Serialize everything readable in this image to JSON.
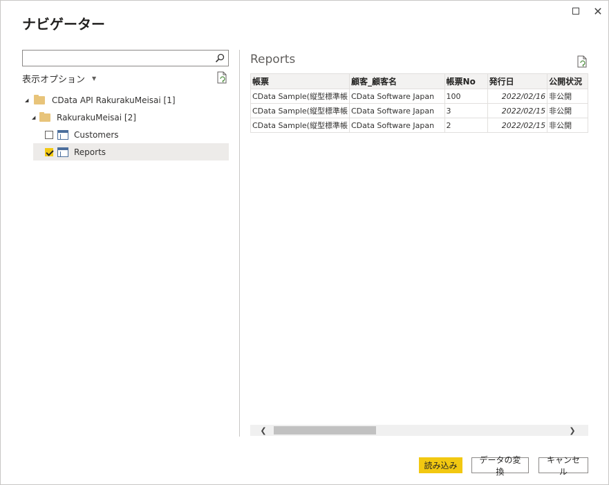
{
  "dialog": {
    "title": "ナビゲーター"
  },
  "left": {
    "search_value": "",
    "display_options_label": "表示オプション",
    "tree": [
      {
        "label": "CData API RakurakuMeisai [1]",
        "kind": "folder",
        "expanded": true
      },
      {
        "label": "RakurakuMeisai [2]",
        "kind": "folder",
        "expanded": true
      },
      {
        "label": "Customers",
        "kind": "table",
        "checked": false
      },
      {
        "label": "Reports",
        "kind": "table",
        "checked": true,
        "selected": true
      }
    ]
  },
  "preview": {
    "title": "Reports",
    "columns": [
      "帳票",
      "顧客_顧客名",
      "帳票No",
      "発行日",
      "公開状況"
    ],
    "rows": [
      [
        "CData Sample(縦型標準帳",
        "CData Software Japan",
        "100",
        "2022/02/16",
        "非公開"
      ],
      [
        "CData Sample(縦型標準帳",
        "CData Software Japan",
        "3",
        "2022/02/15",
        "非公開"
      ],
      [
        "CData Sample(縦型標準帳",
        "CData Software Japan",
        "2",
        "2022/02/15",
        "非公開"
      ]
    ]
  },
  "footer": {
    "load_label": "読み込み",
    "transform_label": "データの変換",
    "cancel_label": "キャンセル"
  },
  "colors": {
    "accent": "#f2c811",
    "folder": "#e8c47a",
    "table_icon": "#4b6e9c"
  },
  "icons": {
    "search": "search-icon",
    "refresh": "refresh-icon",
    "folder": "folder-icon",
    "table": "table-icon",
    "maximize": "maximize-icon",
    "close": "close-icon"
  }
}
